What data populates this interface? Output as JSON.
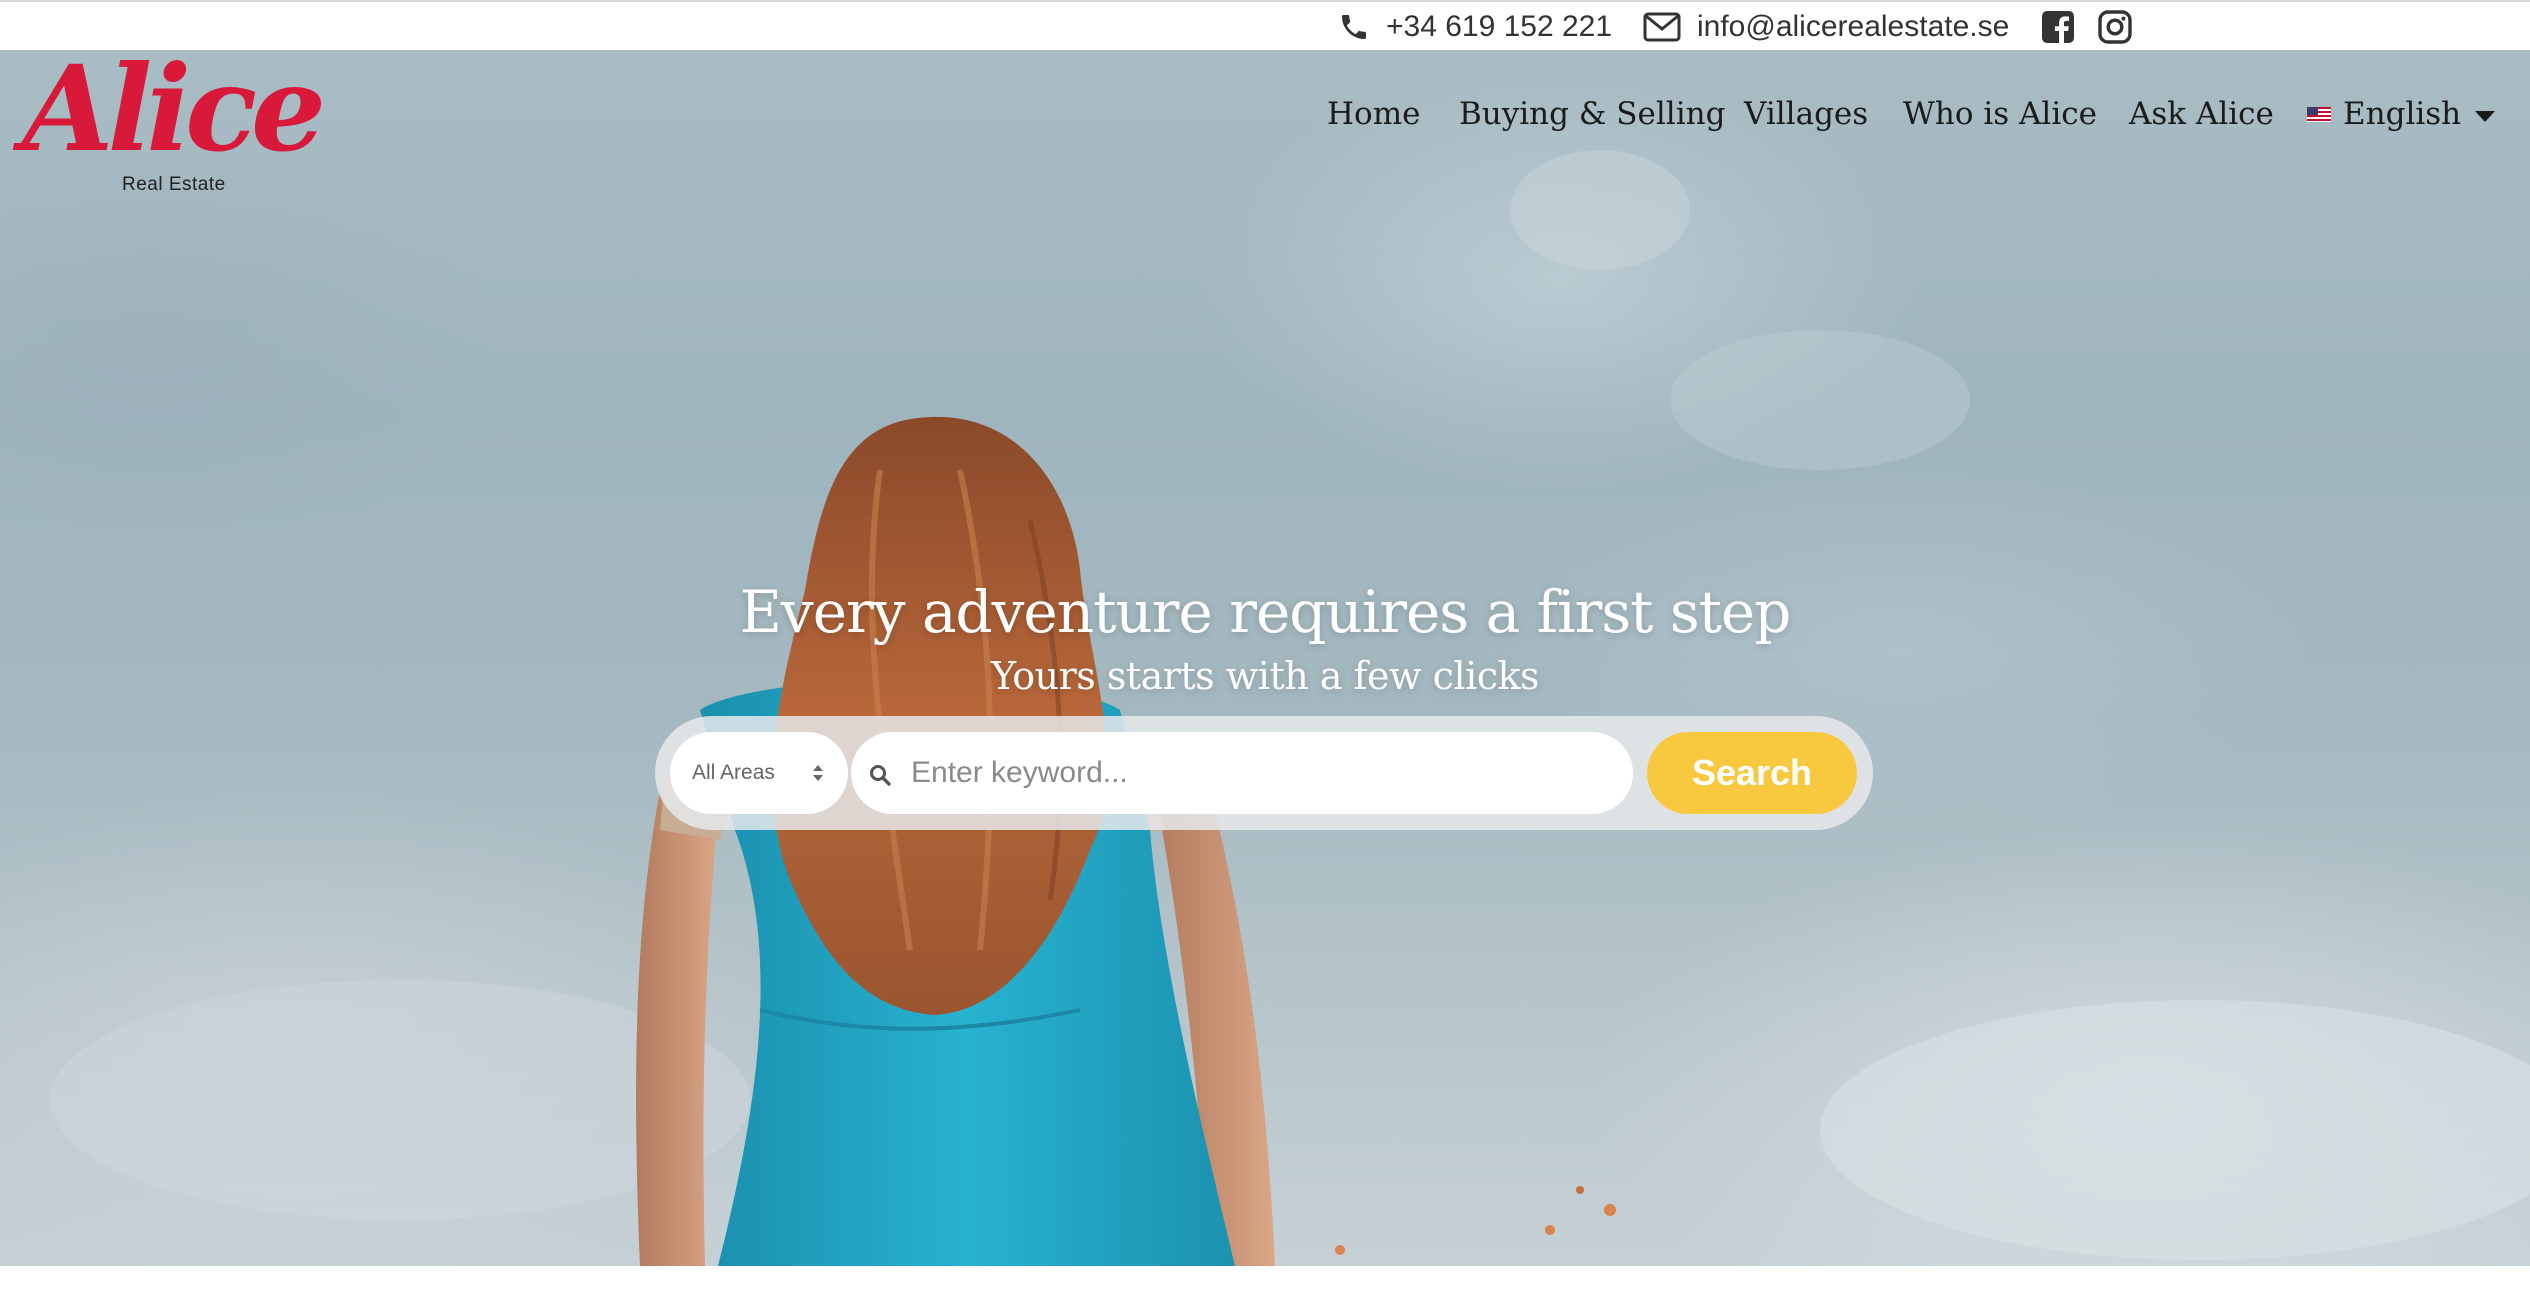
{
  "topbar": {
    "phone": "+34 619 152 221",
    "email": "info@alicerealestate.se",
    "icons": [
      "phone-icon",
      "envelope-icon",
      "facebook-icon",
      "instagram-icon"
    ]
  },
  "brand": {
    "name": "Alice",
    "tagline": "Real Estate",
    "color": "#d8193a"
  },
  "nav": {
    "items": [
      {
        "label": "Home"
      },
      {
        "label": "Buying & Selling"
      },
      {
        "label": "Villages"
      },
      {
        "label": "Who is Alice"
      },
      {
        "label": "Ask Alice"
      }
    ],
    "language": "English"
  },
  "hero": {
    "title": "Every adventure requires a first step",
    "subtitle": "Yours starts with a few clicks"
  },
  "search": {
    "area_selected": "All Areas",
    "keyword_placeholder": "Enter keyword...",
    "button_label": "Search",
    "button_color": "#f8c93f"
  }
}
